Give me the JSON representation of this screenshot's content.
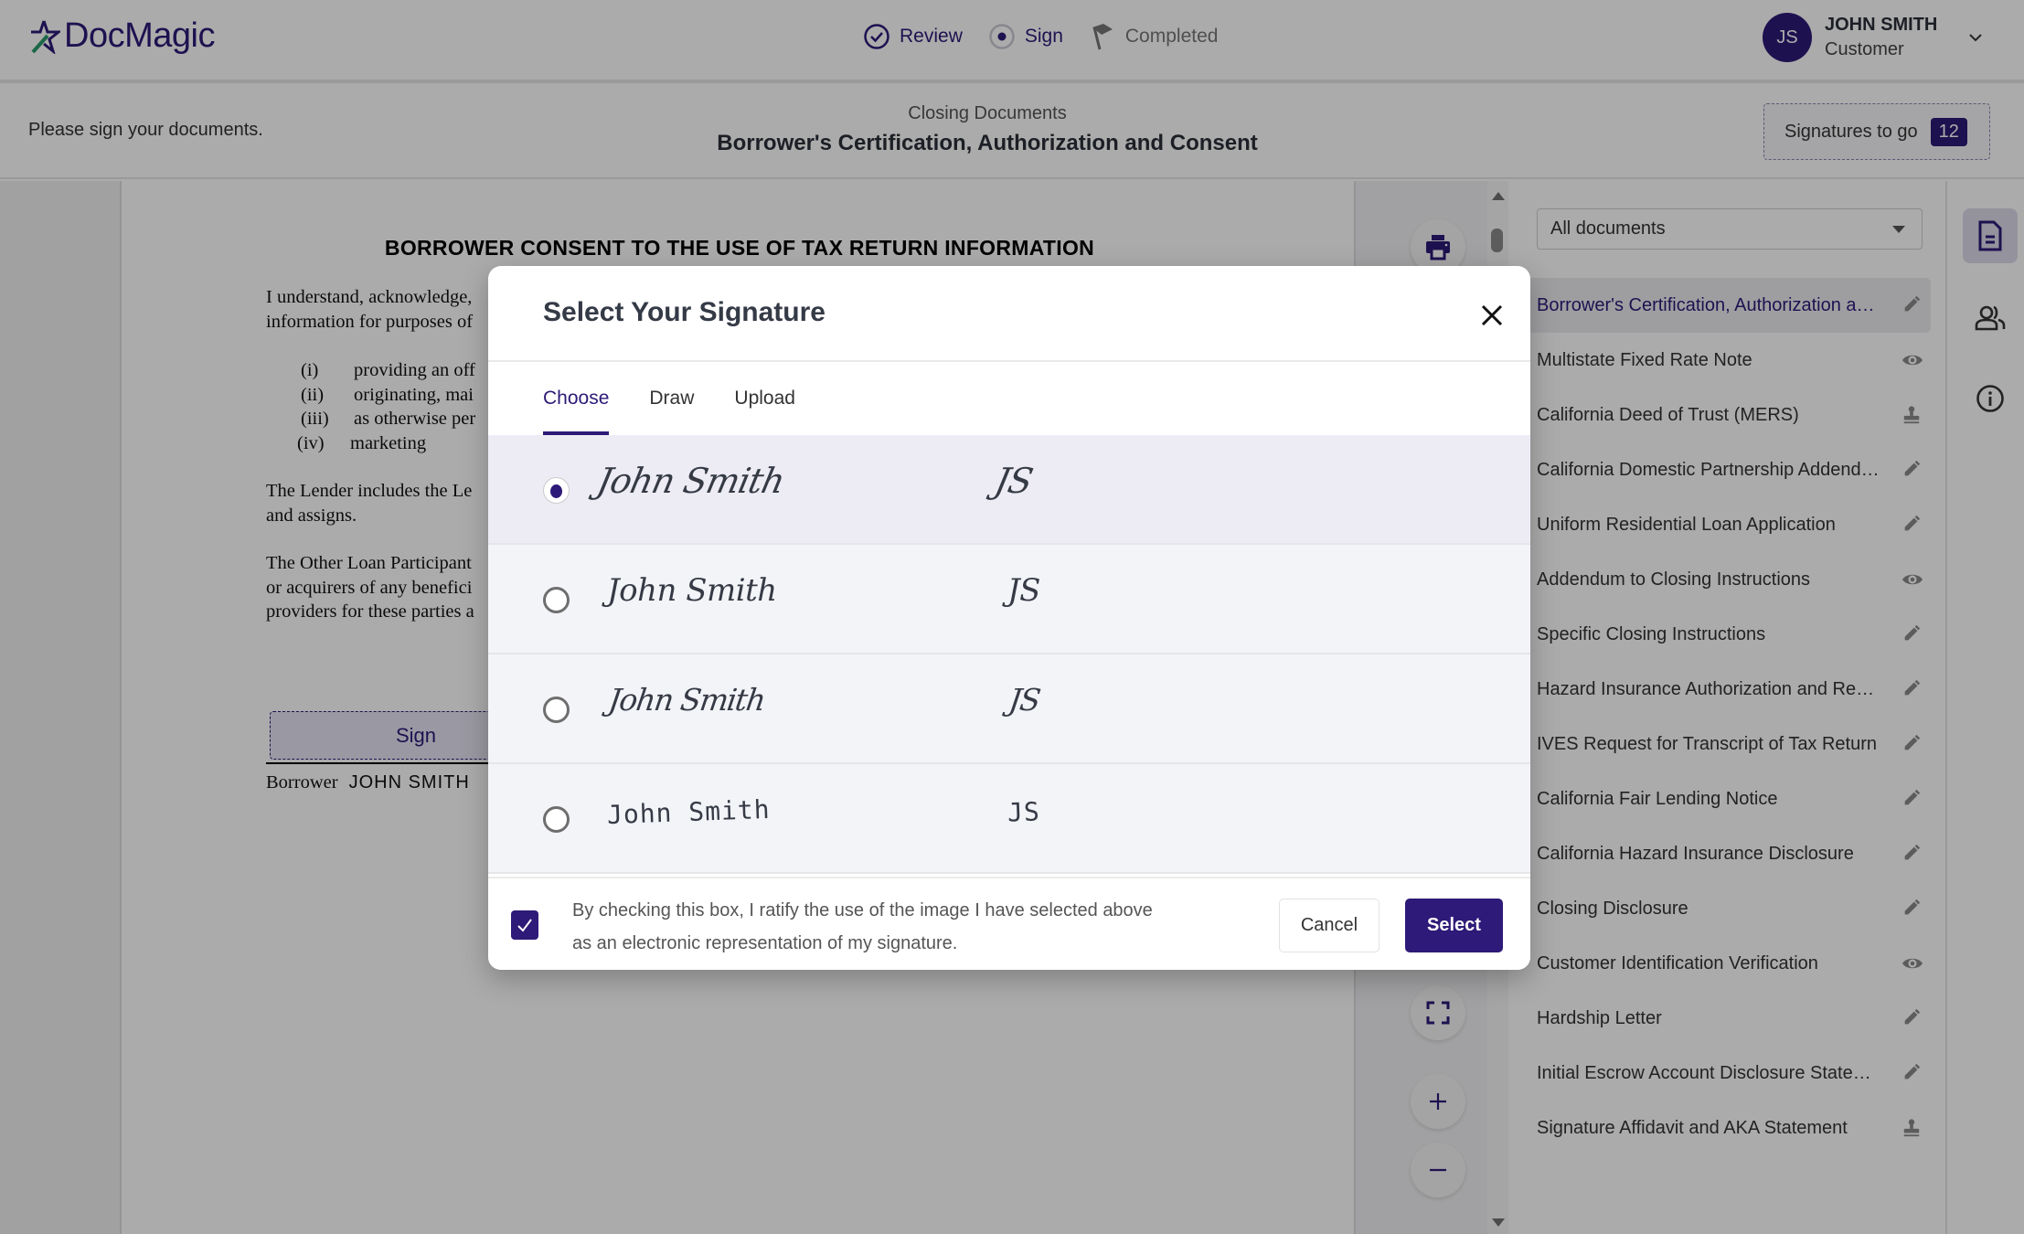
{
  "app": {
    "logo_text": "DocMagic",
    "brand_color": "#2e1a78",
    "accent_green": "#2a9a6a"
  },
  "steps": [
    {
      "label": "Review",
      "state": "done",
      "icon": "check-circle-icon"
    },
    {
      "label": "Sign",
      "state": "current",
      "icon": "radio-dot-icon"
    },
    {
      "label": "Completed",
      "state": "pending",
      "icon": "flag-icon"
    }
  ],
  "user": {
    "initials": "JS",
    "name": "JOHN SMITH",
    "role": "Customer"
  },
  "subheader": {
    "instruction": "Please sign your documents.",
    "breadcrumb": "Closing Documents",
    "title": "Borrower's Certification, Authorization and Consent",
    "signatures_label": "Signatures to go",
    "signatures_count": "12"
  },
  "document": {
    "heading": "BORROWER CONSENT TO THE USE OF TAX RETURN INFORMATION",
    "para1_lines": [
      "I understand, acknowledge,",
      "information for purposes of"
    ],
    "list": [
      {
        "num": "(i)",
        "text": "providing an off"
      },
      {
        "num": "(ii)",
        "text": "originating, mai"
      },
      {
        "num": "(iii)",
        "text": "as otherwise per"
      },
      {
        "num": "(iv)",
        "text": "marketing"
      }
    ],
    "para2_lines": [
      "The Lender includes the Le",
      "and assigns."
    ],
    "para3_lines": [
      "The Other Loan Participant",
      "or acquirers of any benefici",
      "providers for these parties a"
    ],
    "sign_button": "Sign",
    "borrower_label": "Borrower",
    "borrower_name": "JOHN SMITH"
  },
  "sidebar": {
    "filter_value": "All documents",
    "documents": [
      {
        "label": "Borrower's Certification, Authorization and Consent",
        "icon": "pencil-icon",
        "active": true
      },
      {
        "label": "Multistate Fixed Rate Note",
        "icon": "eye-icon"
      },
      {
        "label": "California Deed of Trust (MERS)",
        "icon": "stamp-icon"
      },
      {
        "label": "California Domestic Partnership Addendum",
        "icon": "pencil-icon"
      },
      {
        "label": "Uniform Residential Loan Application",
        "icon": "pencil-icon"
      },
      {
        "label": "Addendum to Closing Instructions",
        "icon": "eye-icon"
      },
      {
        "label": "Specific Closing Instructions",
        "icon": "pencil-icon"
      },
      {
        "label": "Hazard Insurance Authorization and Requirements",
        "icon": "pencil-icon"
      },
      {
        "label": "IVES Request for Transcript of Tax Return",
        "icon": "pencil-icon"
      },
      {
        "label": "California Fair Lending Notice",
        "icon": "pencil-icon"
      },
      {
        "label": "California Hazard Insurance Disclosure",
        "icon": "pencil-icon"
      },
      {
        "label": "Closing Disclosure",
        "icon": "pencil-icon"
      },
      {
        "label": "Customer Identification Verification",
        "icon": "eye-icon"
      },
      {
        "label": "Hardship Letter",
        "icon": "pencil-icon"
      },
      {
        "label": "Initial Escrow Account Disclosure Statement",
        "icon": "pencil-icon"
      },
      {
        "label": "Signature Affidavit and AKA Statement",
        "icon": "stamp-icon"
      }
    ]
  },
  "modal": {
    "title": "Select Your Signature",
    "tabs": [
      {
        "label": "Choose",
        "active": true
      },
      {
        "label": "Draw",
        "active": false
      },
      {
        "label": "Upload",
        "active": false
      }
    ],
    "signatures": [
      {
        "name": "John Smith",
        "initials": "JS",
        "selected": true
      },
      {
        "name": "John Smith",
        "initials": "JS",
        "selected": false
      },
      {
        "name": "John Smith",
        "initials": "JS",
        "selected": false
      },
      {
        "name": "John Smith",
        "initials": "JS",
        "selected": false
      }
    ],
    "ratify_checked": true,
    "ratify_text": "By checking this box, I ratify the use of the image I have selected above as an electronic representation of my signature.",
    "cancel_label": "Cancel",
    "select_label": "Select"
  }
}
